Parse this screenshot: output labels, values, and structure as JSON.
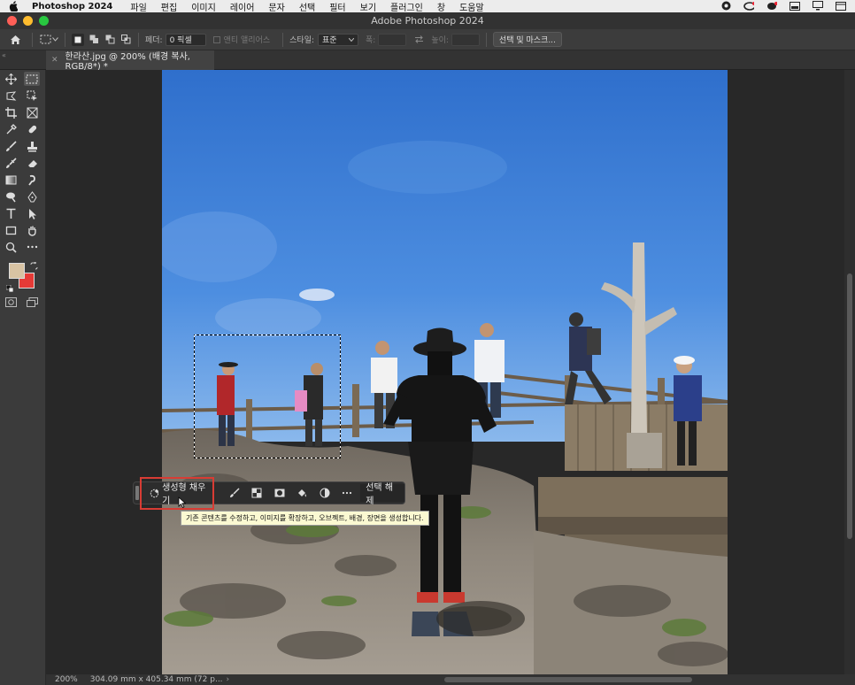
{
  "menubar": {
    "app_name": "Photoshop 2024",
    "items": [
      "파일",
      "편집",
      "이미지",
      "레이어",
      "문자",
      "선택",
      "필터",
      "보기",
      "플러그인",
      "창",
      "도움말"
    ]
  },
  "window": {
    "title": "Adobe Photoshop 2024"
  },
  "options_bar": {
    "feather_label": "페더:",
    "feather_value": "0 픽셀",
    "antialias_label": "앤티 앨리어스",
    "style_label": "스타일:",
    "style_value": "표준",
    "width_label": "폭:",
    "height_label": "높이:",
    "select_mask_label": "선택 및 마스크..."
  },
  "document_tab": {
    "title": "한라산.jpg @ 200% (배경 복사, RGB/8*) *"
  },
  "task_bar": {
    "generative_fill_label": "생성형 채우기",
    "deselect_label": "선택 해제",
    "tooltip": "기존 콘텐츠를 수정하고, 이미지를 확장하고, 오브젝트, 배경, 장면을 생성합니다."
  },
  "status_bar": {
    "zoom": "200%",
    "doc_info": "304.09 mm x 405.34 mm (72 p..."
  },
  "colors": {
    "foreground": "#d8c3a3",
    "background": "#e63a36",
    "highlight": "#d83c34"
  },
  "icons": {
    "menubar_right": [
      "record-icon",
      "creative-cloud-icon",
      "cc-sync-icon",
      "window-icon",
      "display-icon",
      "control-center-icon"
    ]
  }
}
